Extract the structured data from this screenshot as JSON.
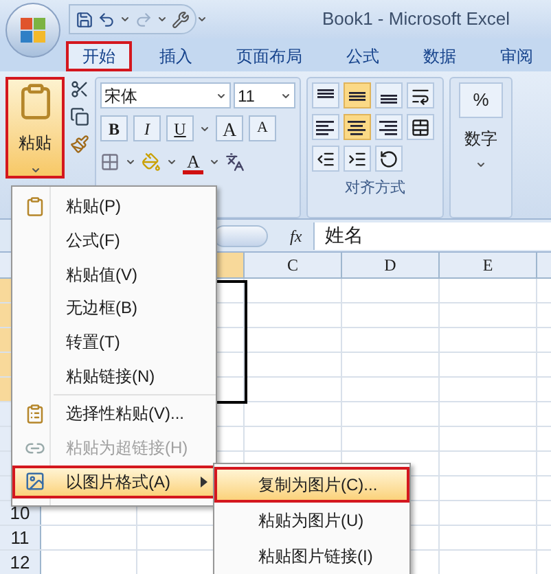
{
  "title_bar": {
    "title": "Book1 - Microsoft Excel"
  },
  "tabs": [
    {
      "label": "开始",
      "selected": true,
      "annotated": true
    },
    {
      "label": "插入",
      "selected": false,
      "annotated": false
    },
    {
      "label": "页面布局",
      "selected": false,
      "annotated": false
    },
    {
      "label": "公式",
      "selected": false,
      "annotated": false
    },
    {
      "label": "数据",
      "selected": false,
      "annotated": false
    },
    {
      "label": "审阅",
      "selected": false,
      "annotated": false
    }
  ],
  "ribbon": {
    "paste_button": {
      "label": "粘贴",
      "annotated": true
    },
    "font": {
      "name": "宋体",
      "size": "11",
      "bold": "B",
      "italic": "I",
      "underline": "U",
      "grow": "A",
      "shrink": "A",
      "font_color": "A"
    },
    "alignment": {
      "label": "对齐方式",
      "buttons": [
        {
          "kind": "top",
          "selected": false
        },
        {
          "kind": "middle",
          "selected": true
        },
        {
          "kind": "bottom",
          "selected": false
        },
        {
          "kind": "wrap",
          "selected": false
        },
        {
          "kind": "left",
          "selected": false
        },
        {
          "kind": "center",
          "selected": true
        },
        {
          "kind": "right",
          "selected": false
        },
        {
          "kind": "merge",
          "selected": false
        },
        {
          "kind": "outdent",
          "selected": false
        },
        {
          "kind": "indent",
          "selected": false
        },
        {
          "kind": "orientation",
          "selected": false
        }
      ]
    },
    "number": {
      "symbol": "%",
      "label": "数字"
    }
  },
  "formula_bar": {
    "fx": "fx",
    "value": "姓名"
  },
  "sheet": {
    "column_headers": [
      "C",
      "D",
      "E"
    ],
    "row_headers": [
      "10",
      "11",
      "12"
    ]
  },
  "context_menu": {
    "items": [
      {
        "kind": "item",
        "label": "粘贴(P)",
        "disabled": false,
        "selected": false,
        "annotated": false,
        "submenu": false
      },
      {
        "kind": "item",
        "label": "公式(F)",
        "disabled": false,
        "selected": false,
        "annotated": false,
        "submenu": false
      },
      {
        "kind": "item",
        "label": "粘贴值(V)",
        "disabled": false,
        "selected": false,
        "annotated": false,
        "submenu": false
      },
      {
        "kind": "item",
        "label": "无边框(B)",
        "disabled": false,
        "selected": false,
        "annotated": false,
        "submenu": false
      },
      {
        "kind": "item",
        "label": "转置(T)",
        "disabled": false,
        "selected": false,
        "annotated": false,
        "submenu": false
      },
      {
        "kind": "item",
        "label": "粘贴链接(N)",
        "disabled": false,
        "selected": false,
        "annotated": false,
        "submenu": false
      },
      {
        "kind": "separator"
      },
      {
        "kind": "item",
        "label": "选择性粘贴(V)...",
        "disabled": false,
        "selected": false,
        "annotated": false,
        "submenu": false
      },
      {
        "kind": "item",
        "label": "粘贴为超链接(H)",
        "disabled": true,
        "selected": false,
        "annotated": false,
        "submenu": false
      },
      {
        "kind": "item",
        "label": "以图片格式(A)",
        "disabled": false,
        "selected": true,
        "annotated": true,
        "submenu": true
      }
    ]
  },
  "submenu": {
    "items": [
      {
        "label": "复制为图片(C)...",
        "selected": true,
        "annotated": true
      },
      {
        "label": "粘贴为图片(U)",
        "selected": false,
        "annotated": false
      },
      {
        "label": "粘贴图片链接(I)",
        "selected": false,
        "annotated": false
      }
    ]
  }
}
